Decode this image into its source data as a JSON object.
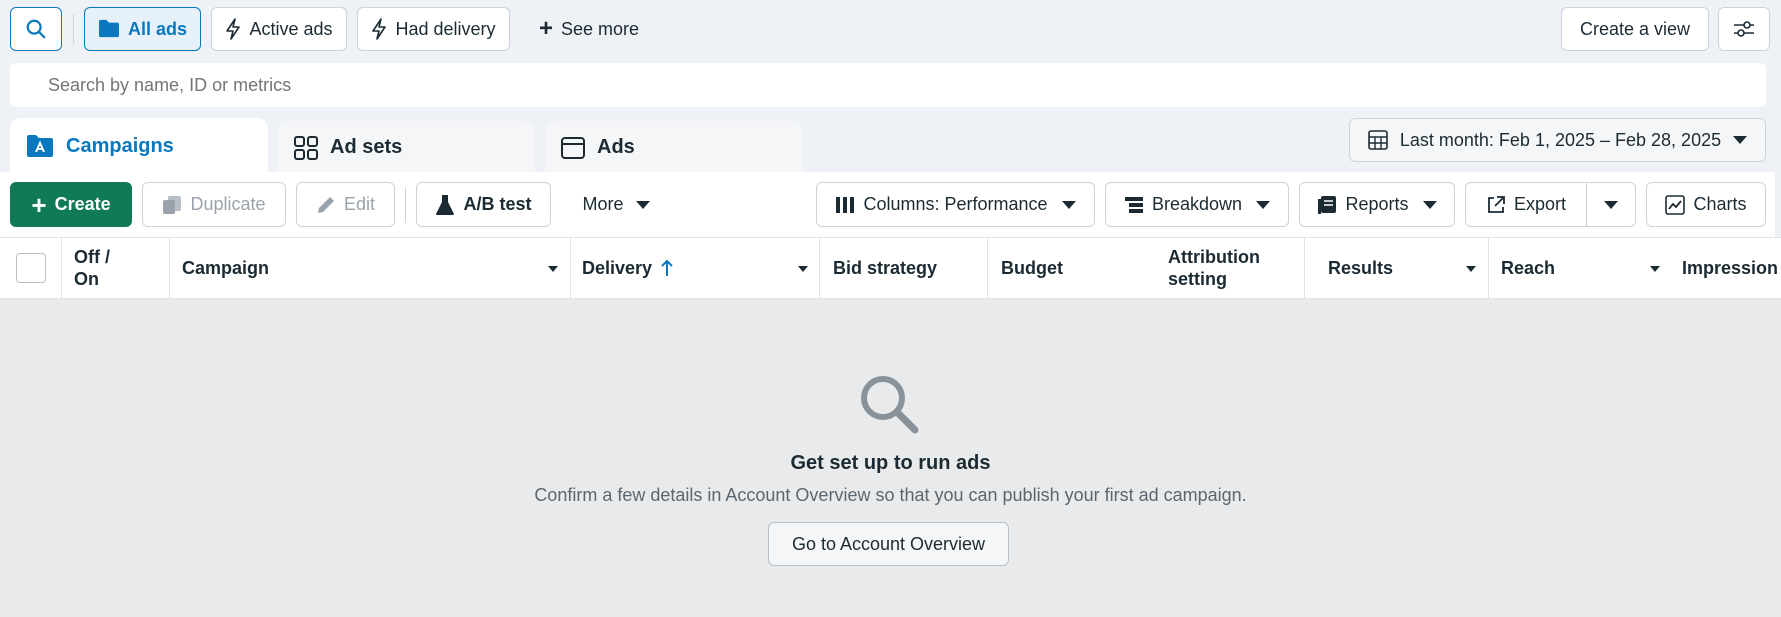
{
  "filters": {
    "search_icon": "search-icon",
    "all_ads": "All ads",
    "active_ads": "Active ads",
    "had_delivery": "Had delivery",
    "see_more": "See more",
    "create_view": "Create a view"
  },
  "search": {
    "placeholder": "Search by name, ID or metrics"
  },
  "tabs": {
    "campaigns": "Campaigns",
    "ad_sets": "Ad sets",
    "ads": "Ads"
  },
  "date_range": "Last month: Feb 1, 2025 – Feb 28, 2025",
  "toolbar": {
    "create": "Create",
    "duplicate": "Duplicate",
    "edit": "Edit",
    "ab_test": "A/B test",
    "more": "More",
    "columns": "Columns: Performance",
    "breakdown": "Breakdown",
    "reports": "Reports",
    "export": "Export",
    "charts": "Charts"
  },
  "table": {
    "headers": {
      "off_on_1": "Off /",
      "off_on_2": "On",
      "campaign": "Campaign",
      "delivery": "Delivery",
      "bid_strategy": "Bid strategy",
      "budget": "Budget",
      "attribution_1": "Attribution",
      "attribution_2": "setting",
      "results": "Results",
      "reach": "Reach",
      "impressions": "Impression"
    }
  },
  "empty_state": {
    "title": "Get set up to run ads",
    "description": "Confirm a few details in Account Overview so that you can publish your first ad campaign.",
    "button": "Go to Account Overview"
  },
  "colors": {
    "accent": "#0a78be",
    "create_green": "#0f7a55",
    "empty_bg": "#e9eaeb"
  }
}
